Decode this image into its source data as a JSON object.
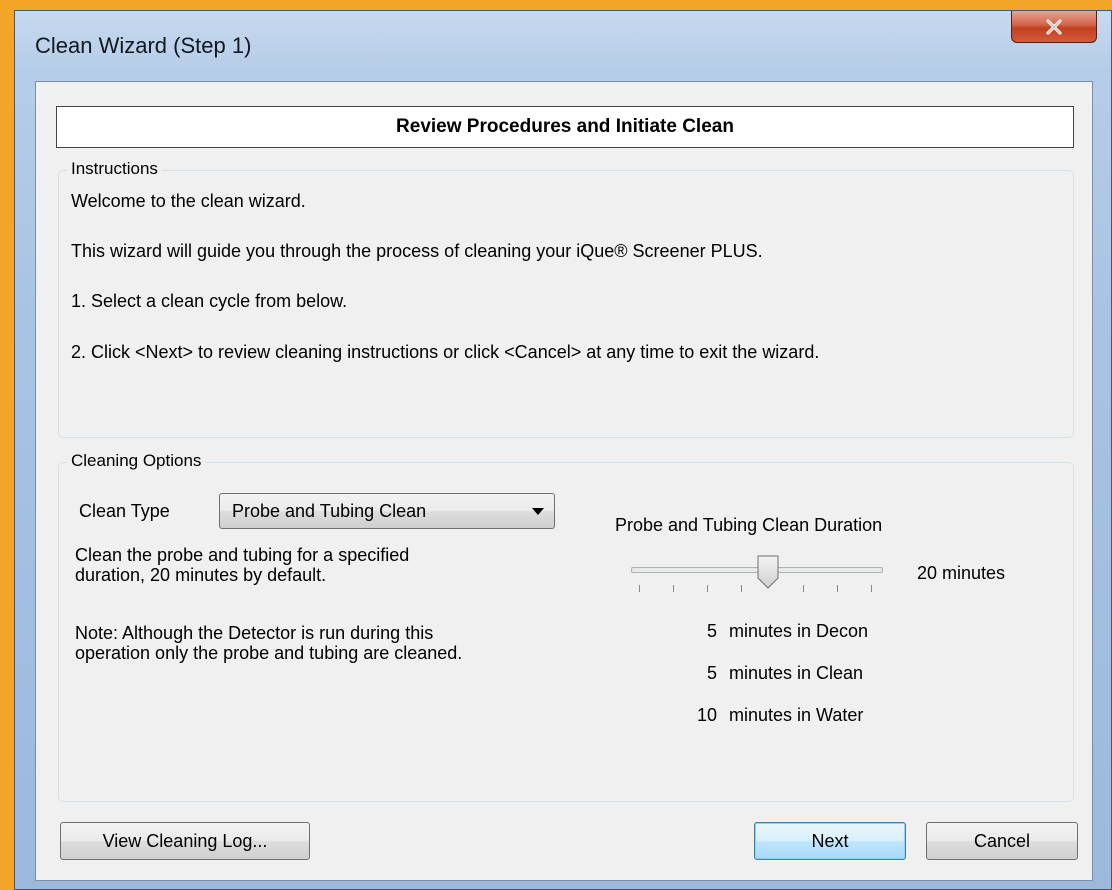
{
  "window": {
    "title": "Clean Wizard (Step 1)",
    "close_icon": "close-x-icon"
  },
  "header": {
    "title": "Review Procedures and Initiate Clean"
  },
  "instructions": {
    "label": "Instructions",
    "lines": [
      "Welcome to the clean wizard.",
      "This wizard will guide you through the process of cleaning your iQue® Screener PLUS.",
      "1.  Select a clean cycle from below.",
      "2.  Click <Next> to review cleaning instructions or click <Cancel> at any time to exit the wizard."
    ]
  },
  "options": {
    "label": "Cleaning Options",
    "clean_type_label": "Clean Type",
    "clean_type_value": "Probe and Tubing Clean",
    "description_line1": "Clean the probe and tubing for a specified",
    "description_line2": "duration, 20 minutes by default.",
    "note_line1": "Note: Although the Detector is run during this",
    "note_line2": "operation only the probe and tubing are cleaned.",
    "duration_label": "Probe and Tubing Clean Duration",
    "duration_value": "20 minutes",
    "slider_position_fraction": 0.5,
    "breakdown": [
      {
        "amount": "5",
        "text": "minutes in Decon"
      },
      {
        "amount": "5",
        "text": "minutes in Clean"
      },
      {
        "amount": "10",
        "text": "minutes in Water"
      }
    ]
  },
  "buttons": {
    "view_log": "View Cleaning Log...",
    "next": "Next",
    "cancel": "Cancel"
  },
  "colors": {
    "background_frame": "#f2a526",
    "window_chrome": "#b6cde8",
    "client_bg": "#f0f0f0",
    "close_button": "#c0401f",
    "default_button_border": "#3c7fb1"
  }
}
